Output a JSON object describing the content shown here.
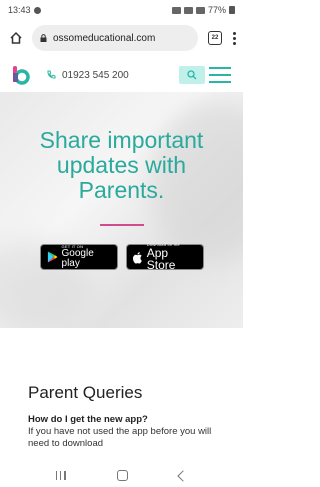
{
  "status_bar": {
    "time": "13:43",
    "battery": "77%"
  },
  "browser": {
    "url": "ossomeducational.com",
    "tab_count": "22",
    "icons": [
      "home-icon",
      "lock-icon",
      "tabs-icon",
      "more-menu-icon"
    ]
  },
  "site_nav": {
    "phone": "01923 545 200",
    "icons": [
      "logo-icon",
      "phone-icon",
      "search-icon",
      "hamburger-menu-icon"
    ]
  },
  "hero": {
    "headline": "Share important updates with Parents.",
    "google_play_small": "GET IT ON",
    "google_play_label": "Google play",
    "app_store_small": "Download on the",
    "app_store_label": "App Store"
  },
  "content": {
    "section_title": "Parent Queries",
    "question": "How do I get the new app?",
    "answer": "If you have not used the app before you will need to download"
  },
  "colors": {
    "brand_teal": "#2aaa9c",
    "accent_pink": "#d04c8c",
    "search_bg": "#bff0ea"
  },
  "system_nav": [
    "recents-icon",
    "home-icon",
    "back-icon"
  ]
}
